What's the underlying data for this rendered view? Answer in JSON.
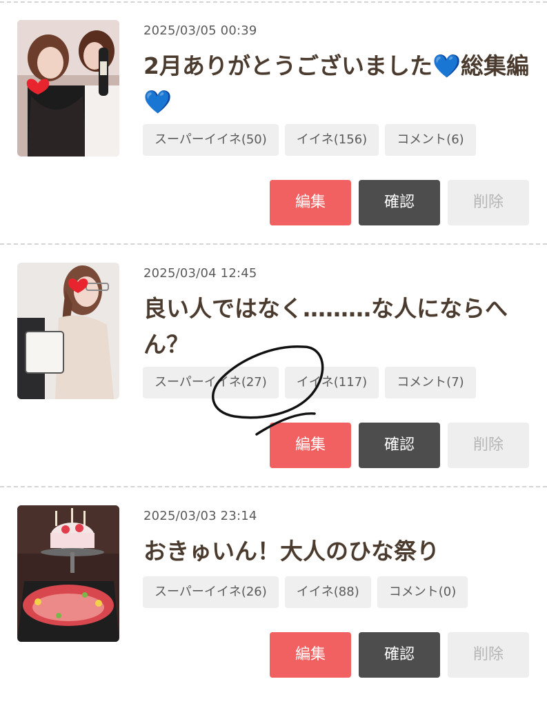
{
  "posts": [
    {
      "date": "2025/03/05 00:39",
      "title": "2月ありがとうございました💙総集編💙",
      "tags": {
        "super_like": "スーパーイイネ(50)",
        "like": "イイネ(156)",
        "comment": "コメント(6)"
      },
      "buttons": {
        "edit": "編集",
        "confirm": "確認",
        "delete": "削除"
      }
    },
    {
      "date": "2025/03/04 12:45",
      "title": "良い人ではなく………な人にならへん？",
      "tags": {
        "super_like": "スーパーイイネ(27)",
        "like": "イイネ(117)",
        "comment": "コメント(7)"
      },
      "buttons": {
        "edit": "編集",
        "confirm": "確認",
        "delete": "削除"
      }
    },
    {
      "date": "2025/03/03 23:14",
      "title": "おきゅいん！大人のひな祭り",
      "tags": {
        "super_like": "スーパーイイネ(26)",
        "like": "イイネ(88)",
        "comment": "コメント(0)"
      },
      "buttons": {
        "edit": "編集",
        "confirm": "確認",
        "delete": "削除"
      }
    }
  ],
  "colors": {
    "edit": "#f26161",
    "confirm": "#4d4d4d",
    "delete": "#eeeeee",
    "tag_bg": "#efefef",
    "title": "#4a3b2e",
    "heart_blue": "#1e7fe0",
    "heart_red": "#e8242f"
  }
}
